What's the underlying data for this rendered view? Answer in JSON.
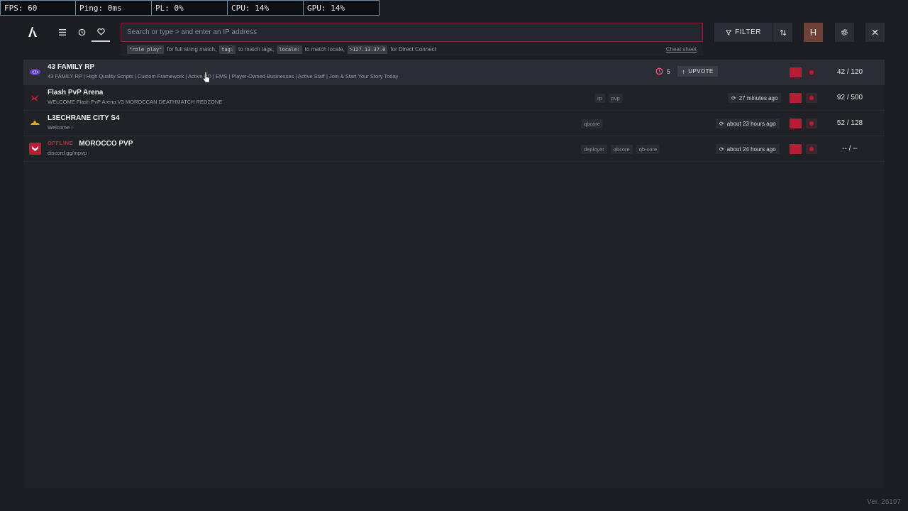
{
  "perf": {
    "fps": "FPS: 60",
    "ping": "Ping: 0ms",
    "pl": "PL: 0%",
    "cpu": "CPU: 14%",
    "gpu": "GPU: 14%"
  },
  "toolbar": {
    "menu_icon": "menu-icon",
    "history_icon": "history-icon",
    "favorites_icon": "heart-icon",
    "search_placeholder": "Search or type > and enter an IP address",
    "filter_label": "FILTER",
    "avatar_letter": "H"
  },
  "hints": [
    {
      "code": "\"role play\"",
      "text": "for full string match,"
    },
    {
      "code": "tag:",
      "text": "to match tags,"
    },
    {
      "code": "locale:",
      "text": "to match locale,"
    },
    {
      "code": ">127.13.37.0",
      "text": "for Direct Connect"
    }
  ],
  "cheat_sheet": "Cheat sheet",
  "servers": [
    {
      "name": "43 FAMILY RP",
      "description": "43 FAMILY RP | High Quality Scripts | Custom Framework | Active PD | EMS | Player-Owned Businesses | Active Staff | Join & Start Your Story Today",
      "boosts": "5",
      "upvote": "UPVOTE",
      "players": "42 / 120"
    },
    {
      "name": "Flash PvP Arena",
      "description": "WELCOME Flash PvP Arena V3 MOROCCAN DEATHMATCH REDZONE",
      "tags": [
        "rp",
        "pvp"
      ],
      "last_seen": "27 minutes ago",
      "players": "92 / 500"
    },
    {
      "name": "L3ECHRANE CITY S4",
      "description": "Welcome !",
      "tags": [
        "qbcore"
      ],
      "last_seen": "about 23 hours ago",
      "players": "52 / 128"
    },
    {
      "name": "MOROCCO PVP",
      "status": "OFFLINE",
      "description": "discord.gg/mpvp",
      "tags": [
        "deployer",
        "qbcore",
        "qb-core"
      ],
      "last_seen": "about 24 hours ago",
      "players": "-- / --"
    }
  ],
  "colors": {
    "accent": "#b51f35",
    "avatar": "#6e4236",
    "boost": "#d9547c"
  },
  "version": "Ver. 26197"
}
